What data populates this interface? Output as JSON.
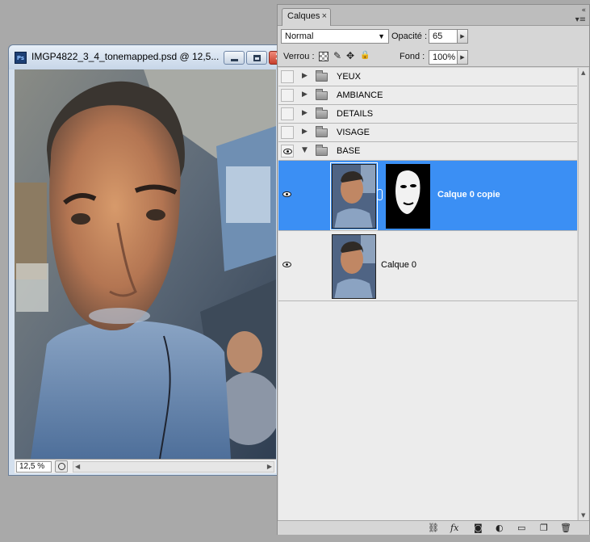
{
  "document_window": {
    "app_badge": "Ps",
    "title": "IMGP4822_3_4_tonemapped.psd @ 12,5...",
    "zoom": "12,5 %"
  },
  "layers_panel": {
    "tab_label": "Calques",
    "tab_close": "×",
    "collapse_glyph": "«",
    "menu_glyph": "▾≡",
    "blend_mode": "Normal",
    "opacity_label": "Opacité :",
    "opacity_value": "65",
    "lock_label": "Verrou :",
    "fill_label": "Fond :",
    "fill_value": "100%",
    "groups": [
      {
        "name": "YEUX",
        "visible": false,
        "expanded": false
      },
      {
        "name": "AMBIANCE",
        "visible": false,
        "expanded": false
      },
      {
        "name": "DETAILS",
        "visible": false,
        "expanded": false
      },
      {
        "name": "VISAGE",
        "visible": false,
        "expanded": false
      },
      {
        "name": "BASE",
        "visible": true,
        "expanded": true
      }
    ],
    "layers": [
      {
        "name": "Calque 0 copie",
        "visible": true,
        "selected": true,
        "has_mask": true
      },
      {
        "name": "Calque 0",
        "visible": true,
        "selected": false,
        "has_mask": false
      }
    ],
    "footer_icons": [
      "link-layers-icon",
      "fx-icon",
      "add-mask-icon",
      "adjustment-layer-icon",
      "new-group-icon",
      "new-layer-icon",
      "trash-icon"
    ]
  },
  "colors": {
    "selection": "#3b8ff4",
    "panel_bg": "#d6d6d6",
    "layers_bg": "#ececec",
    "desktop": "#a9a9a9"
  }
}
